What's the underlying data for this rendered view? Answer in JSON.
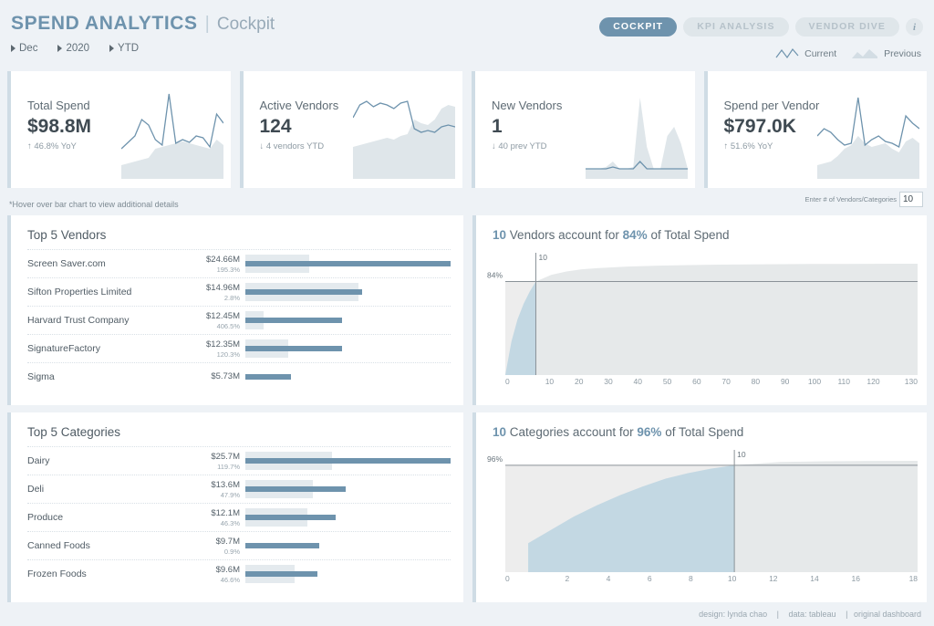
{
  "header": {
    "title_main": "SPEND ANALYTICS",
    "title_separator": "|",
    "title_sub": "Cockpit",
    "breadcrumbs": [
      {
        "label": "Dec"
      },
      {
        "label": "2020"
      },
      {
        "label": "YTD"
      }
    ],
    "nav_pills": [
      {
        "label": "COCKPIT",
        "active": true
      },
      {
        "label": "KPI ANALYSIS",
        "active": false
      },
      {
        "label": "VENDOR DIVE",
        "active": false
      }
    ],
    "info_icon": "info-icon",
    "legend": [
      {
        "label": "Current",
        "icon": "line-icon",
        "color": "#6e93ad"
      },
      {
        "label": "Previous",
        "icon": "area-icon",
        "color": "#d3dde4"
      }
    ]
  },
  "kpis": [
    {
      "label": "Total Spend",
      "value": "$98.8M",
      "delta": "↑ 46.8% YoY",
      "spark": [
        62,
        55,
        48,
        30,
        36,
        52,
        58,
        2,
        56,
        52,
        55,
        48,
        50,
        60,
        24,
        34
      ],
      "area": [
        80,
        78,
        76,
        74,
        72,
        62,
        60,
        58,
        56,
        54,
        56,
        58,
        60,
        62,
        52,
        58
      ]
    },
    {
      "label": "Active Vendors",
      "value": "124",
      "delta": "↓ 4 vendors YTD",
      "spark": [
        28,
        14,
        10,
        16,
        12,
        14,
        18,
        12,
        10,
        40,
        44,
        42,
        44,
        38,
        36,
        38
      ],
      "area": [
        60,
        58,
        56,
        54,
        52,
        50,
        52,
        48,
        46,
        30,
        34,
        36,
        30,
        18,
        14,
        16
      ]
    },
    {
      "label": "New Vendors",
      "value": "1",
      "delta": "↓ 40 prev YTD",
      "spark": [
        84,
        84,
        84,
        84,
        82,
        84,
        84,
        84,
        76,
        84,
        84,
        84,
        84,
        84,
        84,
        84
      ],
      "area": [
        84,
        84,
        84,
        82,
        76,
        84,
        84,
        82,
        6,
        60,
        84,
        84,
        48,
        38,
        56,
        84
      ]
    },
    {
      "label": "Spend per Vendor",
      "value": "$797.0K",
      "delta": "↑ 51.6% YoY",
      "spark": [
        48,
        40,
        44,
        52,
        58,
        56,
        6,
        58,
        52,
        48,
        54,
        56,
        60,
        26,
        34,
        40
      ],
      "area": [
        80,
        78,
        76,
        70,
        62,
        58,
        48,
        56,
        60,
        58,
        56,
        62,
        66,
        54,
        50,
        56
      ]
    }
  ],
  "hint": "*Hover over bar chart to view additional details",
  "vendor_count_input": {
    "label": "Enter # of Vendors/Categories",
    "value": "10"
  },
  "top_vendors": {
    "title": "Top 5 Vendors",
    "rows": [
      {
        "name": "Screen Saver.com",
        "amount": "$24.66M",
        "pct": "195.3%",
        "fg": 100,
        "bg": 31
      },
      {
        "name": "Sifton Properties Limited",
        "amount": "$14.96M",
        "pct": "2.8%",
        "fg": 57,
        "bg": 55
      },
      {
        "name": "Harvard Trust Company",
        "amount": "$12.45M",
        "pct": "406.5%",
        "fg": 47,
        "bg": 9
      },
      {
        "name": "SignatureFactory",
        "amount": "$12.35M",
        "pct": "120.3%",
        "fg": 47,
        "bg": 21
      },
      {
        "name": "Sigma",
        "amount": "$5.73M",
        "pct": "",
        "fg": 22,
        "bg": 0
      }
    ]
  },
  "top_categories": {
    "title": "Top 5 Categories",
    "rows": [
      {
        "name": "Dairy",
        "amount": "$25.7M",
        "pct": "119.7%",
        "fg": 100,
        "bg": 42
      },
      {
        "name": "Deli",
        "amount": "$13.6M",
        "pct": "47.9%",
        "fg": 49,
        "bg": 33
      },
      {
        "name": "Produce",
        "amount": "$12.1M",
        "pct": "46.3%",
        "fg": 44,
        "bg": 30
      },
      {
        "name": "Canned Foods",
        "amount": "$9.7M",
        "pct": "0.9%",
        "fg": 36,
        "bg": 0
      },
      {
        "name": "Frozen Foods",
        "amount": "$9.6M",
        "pct": "46.6%",
        "fg": 35,
        "bg": 24
      }
    ]
  },
  "chart_data": [
    {
      "type": "area",
      "name": "vendor-pareto",
      "title_count": "10",
      "title_mid": "Vendors account for",
      "title_pct": "84%",
      "title_end": "of Total Spend",
      "xlabel": "",
      "ylabel": "",
      "xticks": [
        "0",
        "10",
        "20",
        "30",
        "40",
        "50",
        "60",
        "70",
        "80",
        "90",
        "100",
        "110",
        "120",
        "130"
      ],
      "xlim": [
        0,
        135
      ],
      "ylim": [
        0,
        100
      ],
      "ref_line_x": 10,
      "ref_line_x_label": "10",
      "ref_line_y": 84,
      "ref_line_y_label": "84%",
      "x": [
        0,
        2,
        4,
        6,
        8,
        10,
        15,
        20,
        25,
        30,
        40,
        50,
        60,
        70,
        80,
        90,
        100,
        110,
        120,
        130,
        135
      ],
      "cumulative_pct": [
        0,
        30,
        50,
        64,
        75,
        84,
        90,
        93,
        95,
        96,
        97.5,
        98.3,
        98.8,
        99.2,
        99.4,
        99.6,
        99.75,
        99.85,
        99.95,
        100,
        100
      ]
    },
    {
      "type": "area",
      "name": "category-pareto",
      "title_count": "10",
      "title_mid": "Categories account for",
      "title_pct": "96%",
      "title_end": "of Total Spend",
      "xlabel": "",
      "ylabel": "",
      "xticks": [
        "0",
        "2",
        "4",
        "6",
        "8",
        "10",
        "12",
        "14",
        "16",
        "18"
      ],
      "xlim": [
        0,
        18
      ],
      "ylim": [
        0,
        100
      ],
      "ref_line_x": 10,
      "ref_line_x_label": "10",
      "ref_line_y": 96,
      "ref_line_y_label": "96%",
      "x": [
        1,
        2,
        3,
        4,
        5,
        6,
        7,
        8,
        9,
        10,
        12,
        14,
        16,
        18
      ],
      "cumulative_pct": [
        26,
        38,
        50,
        60,
        69,
        77,
        84,
        89,
        93,
        96,
        99,
        99.6,
        99.9,
        100
      ]
    }
  ],
  "footer": {
    "design": "design: lynda chao",
    "sep1": "|",
    "data": "data: tableau",
    "sep2": "|",
    "link": "original dashboard"
  }
}
